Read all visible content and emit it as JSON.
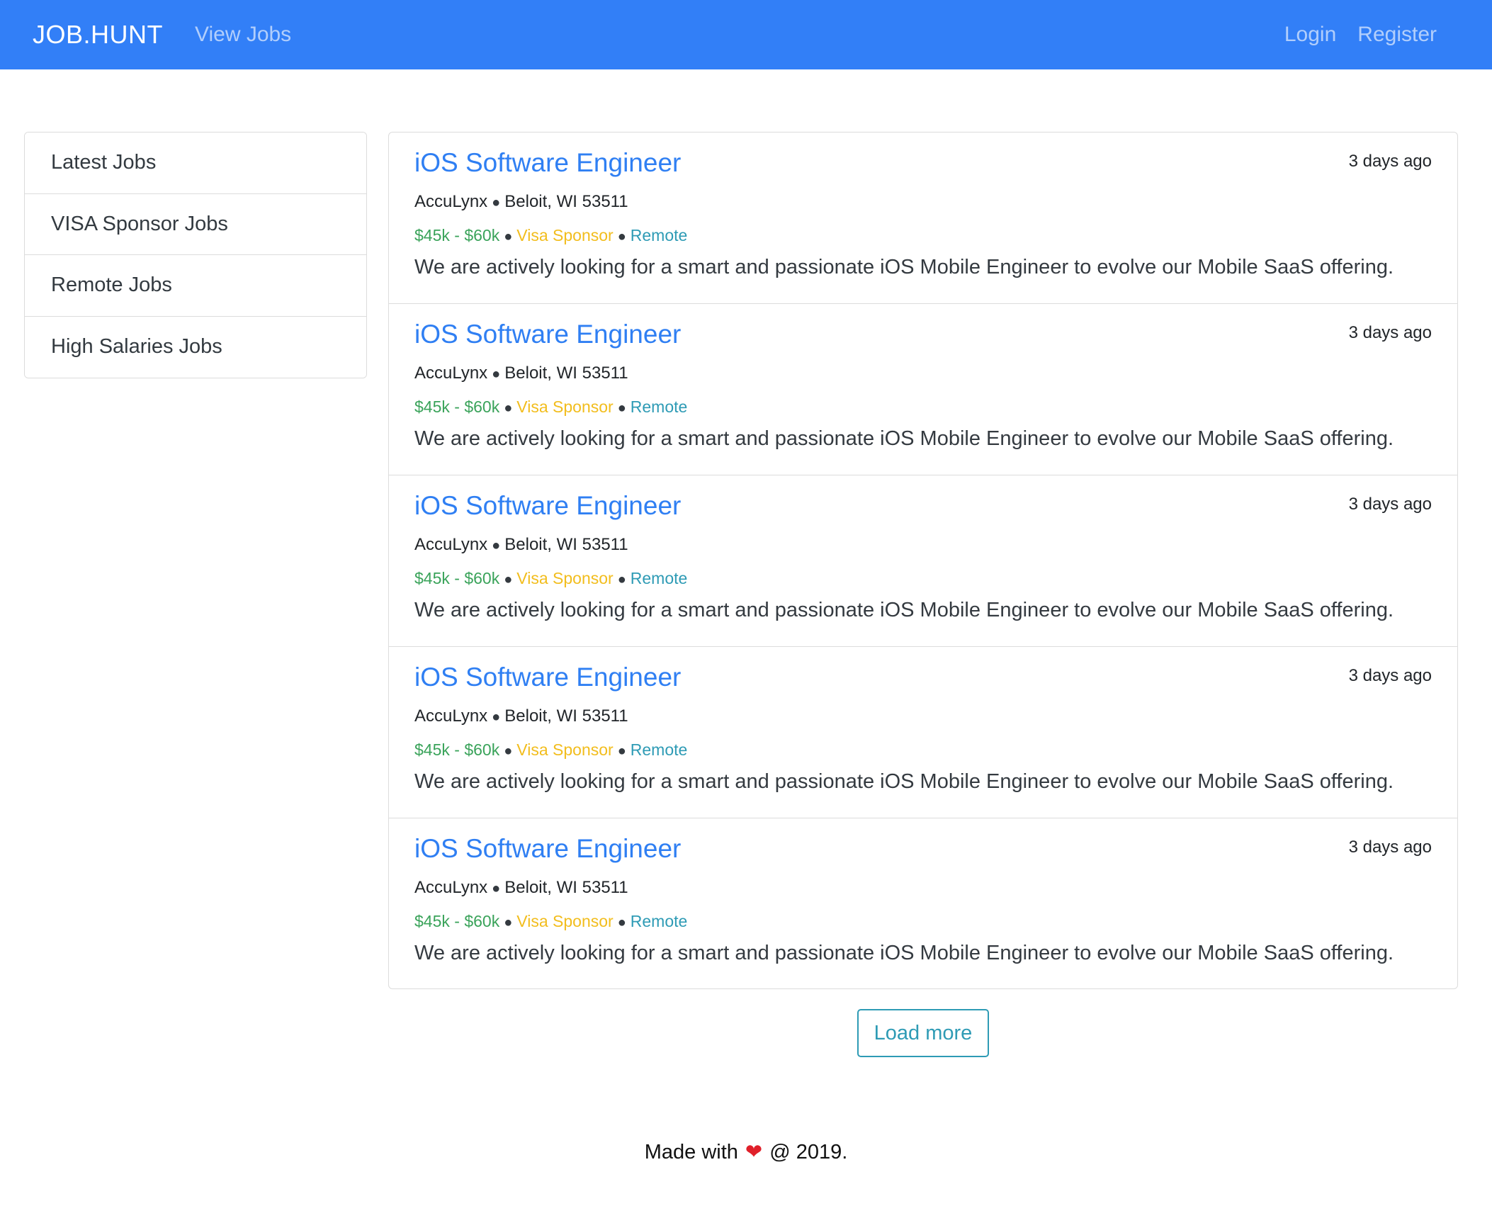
{
  "navbar": {
    "brand": "JOB.HUNT",
    "view_jobs": "View Jobs",
    "login": "Login",
    "register": "Register",
    "bg_color": "#327ff7"
  },
  "sidebar": {
    "items": [
      {
        "label": "Latest Jobs"
      },
      {
        "label": "VISA Sponsor Jobs"
      },
      {
        "label": "Remote Jobs"
      },
      {
        "label": "High Salaries Jobs"
      }
    ]
  },
  "jobs": [
    {
      "title": "iOS Software Engineer",
      "posted": "3 days ago",
      "company": "AccuLynx",
      "location": "Beloit, WI 53511",
      "salary": "$45k - $60k",
      "visa": "Visa Sponsor",
      "remote": "Remote",
      "description": "We are actively looking for a smart and passionate iOS Mobile Engineer to evolve our Mobile SaaS offering."
    },
    {
      "title": "iOS Software Engineer",
      "posted": "3 days ago",
      "company": "AccuLynx",
      "location": "Beloit, WI 53511",
      "salary": "$45k - $60k",
      "visa": "Visa Sponsor",
      "remote": "Remote",
      "description": "We are actively looking for a smart and passionate iOS Mobile Engineer to evolve our Mobile SaaS offering."
    },
    {
      "title": "iOS Software Engineer",
      "posted": "3 days ago",
      "company": "AccuLynx",
      "location": "Beloit, WI 53511",
      "salary": "$45k - $60k",
      "visa": "Visa Sponsor",
      "remote": "Remote",
      "description": "We are actively looking for a smart and passionate iOS Mobile Engineer to evolve our Mobile SaaS offering."
    },
    {
      "title": "iOS Software Engineer",
      "posted": "3 days ago",
      "company": "AccuLynx",
      "location": "Beloit, WI 53511",
      "salary": "$45k - $60k",
      "visa": "Visa Sponsor",
      "remote": "Remote",
      "description": "We are actively looking for a smart and passionate iOS Mobile Engineer to evolve our Mobile SaaS offering."
    },
    {
      "title": "iOS Software Engineer",
      "posted": "3 days ago",
      "company": "AccuLynx",
      "location": "Beloit, WI 53511",
      "salary": "$45k - $60k",
      "visa": "Visa Sponsor",
      "remote": "Remote",
      "description": "We are actively looking for a smart and passionate iOS Mobile Engineer to evolve our Mobile SaaS offering."
    }
  ],
  "load_more": "Load more",
  "footer": {
    "prefix": "Made with",
    "heart_icon": "heart-icon",
    "suffix": "@ 2019."
  },
  "colors": {
    "title": "#2f7ff3",
    "salary": "#3aa35a",
    "visa": "#f2bd1d",
    "remote": "#2e9bb5"
  }
}
